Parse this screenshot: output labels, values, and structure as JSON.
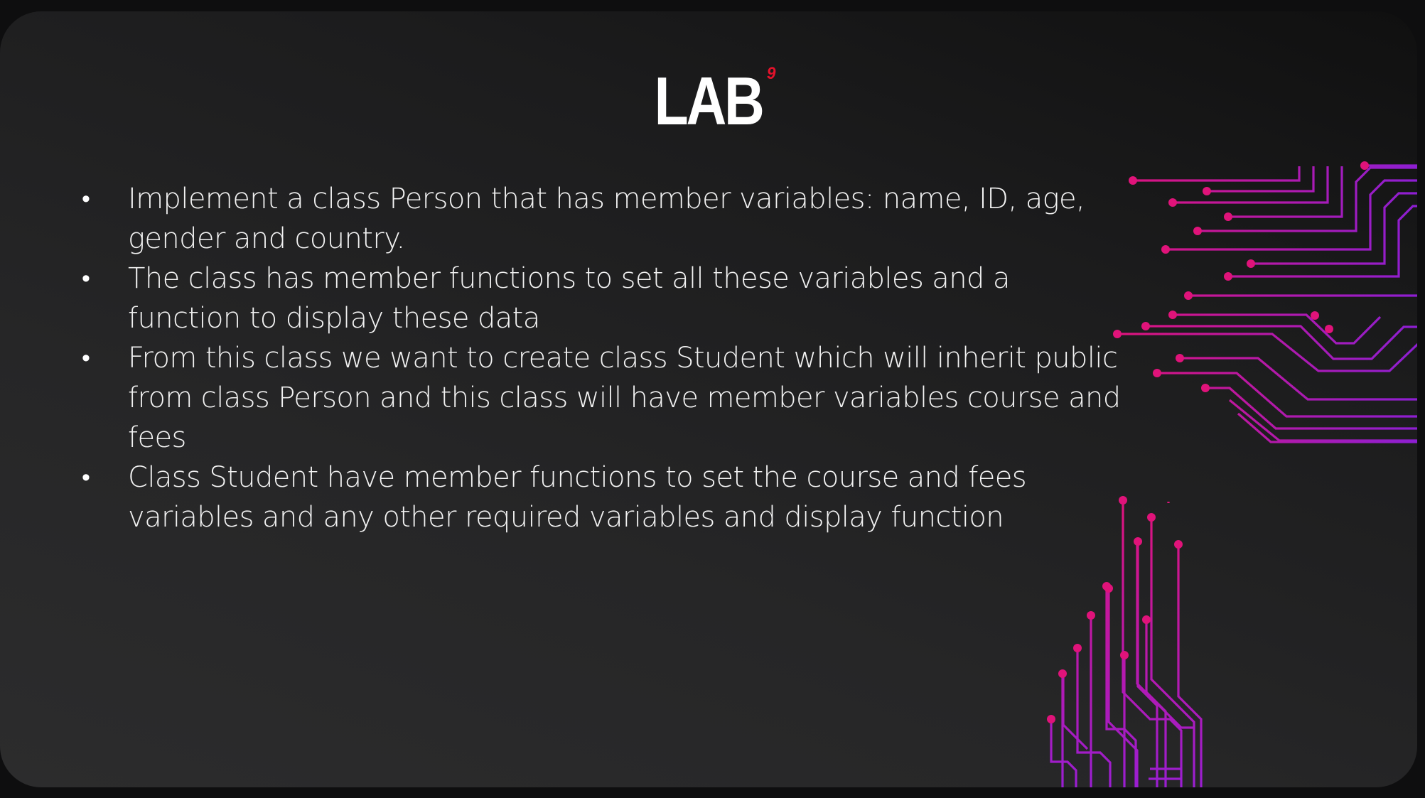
{
  "slide": {
    "title": "LAB",
    "title_superscript": "9",
    "bullets": [
      "Implement a class Person that has member variables: name, ID, age, gender and country.",
      "The class has member functions to set all these variables and a function to display these data",
      "From this class we want to create class Student which will inherit public from class Person and this class will have member variables course and fees",
      "Class Student have member functions to set the course and fees variables and any other required variables and display function"
    ],
    "bullet_glyph": "•"
  },
  "colors": {
    "background": "#0e0e0f",
    "slide_dark": "#101010",
    "slide_light": "#2c2c2d",
    "title": "#ffffff",
    "superscript": "#e3122b",
    "body_text": "#f2f2f2",
    "circuit_magenta": "#e0137a",
    "circuit_purple": "#8a1fd6"
  },
  "decorations": {
    "right_circuit": "circuit-traces",
    "bottom_circuit": "circuit-traces"
  }
}
